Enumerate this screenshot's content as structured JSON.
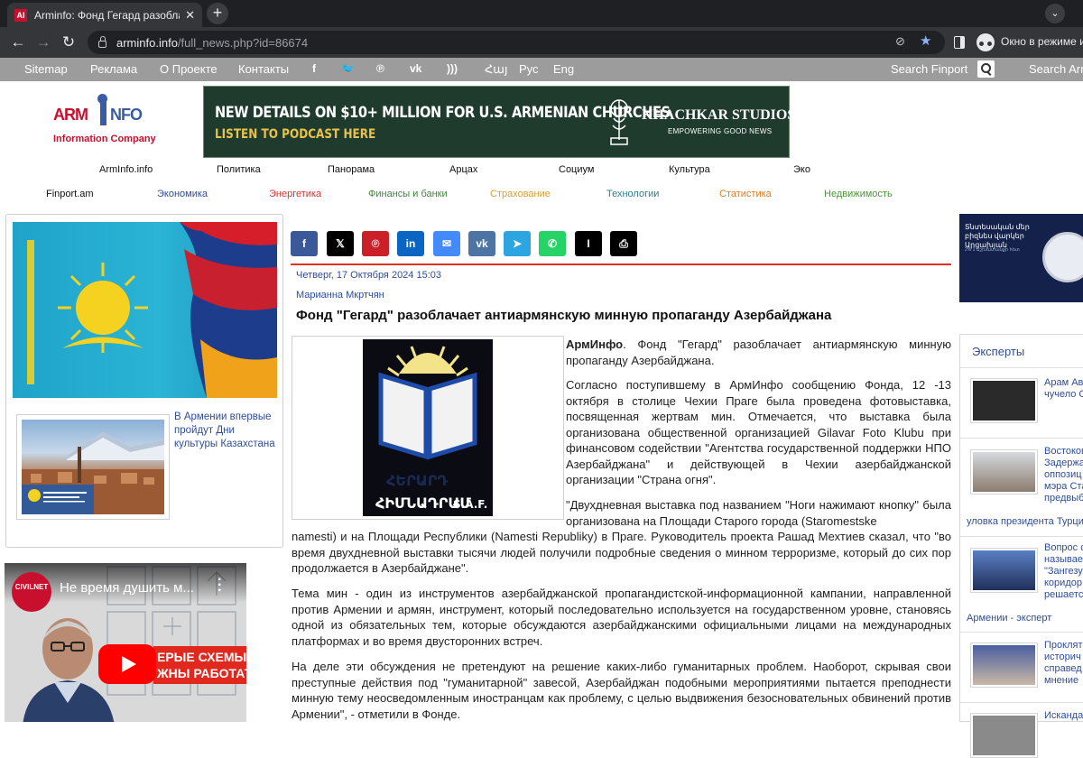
{
  "browser": {
    "tab_title": "Arminfo: Фонд Гегард разоблача",
    "favicon_text": "AI",
    "url_host": "arminfo.info",
    "url_path": "/full_news.php?id=86674",
    "incognito_label": "Окно в режиме инк"
  },
  "site_nav": {
    "links": [
      "Sitemap",
      "Реклама",
      "О Проекте",
      "Контакты"
    ],
    "social_icons": [
      "facebook-icon",
      "twitter-icon",
      "pinterest-icon",
      "vk-icon",
      "rss-icon"
    ],
    "languages": [
      "Հայ",
      "Рус",
      "Eng"
    ],
    "search_finport": "Search Finport",
    "search_arminfo": "Search Arm"
  },
  "logo": {
    "arm": "ARM",
    "info": "NFO",
    "company": "Information  Company"
  },
  "banner": {
    "headline": "NEW DETAILS ON $10+ MILLION FOR U.S. ARMENIAN CHURCHES",
    "cta": "LISTEN TO PODCAST HERE",
    "brand": "KHACHKAR STUDIOS",
    "tagline": "EMPOWERING GOOD NEWS"
  },
  "menu_row1": [
    "ArmInfo.info",
    "Политика",
    "Панорама",
    "Арцах",
    "Социум",
    "Культура",
    "Эко"
  ],
  "menu_row2": [
    "Finport.am",
    "Экономика",
    "Энергетика",
    "Финансы и банки",
    "Страхование",
    "Технологии",
    "Статистика",
    "Недвижимость"
  ],
  "colors": {
    "link_blue": "#2e4d9b",
    "energy_red": "#d9322b",
    "finance_green": "#3e8a3a",
    "insurance_gold": "#d4a23a",
    "tech_teal": "#2f7f8a",
    "stats_orange": "#e07a1f",
    "realty_green": "#4a9a34",
    "accent_red": "#e0341f"
  },
  "left": {
    "thumb_caption": "В Армении впервые пройдут Дни культуры Казахстана"
  },
  "video": {
    "channel_badge": "CIVILNET",
    "title": "Не время душить м...",
    "overlay_line1": "ЕРЫЕ СХЕМЫ",
    "overlay_line2": "ЖНЫ РАБОТАТ"
  },
  "share_buttons": [
    {
      "name": "facebook-share-button",
      "glyph": "f",
      "color": "#3b5998"
    },
    {
      "name": "x-share-button",
      "glyph": "𝕏",
      "color": "#000000"
    },
    {
      "name": "pinterest-share-button",
      "glyph": "℗",
      "color": "#cb2027"
    },
    {
      "name": "linkedin-share-button",
      "glyph": "in",
      "color": "#0a66c2"
    },
    {
      "name": "messenger-share-button",
      "glyph": "✉",
      "color": "#448aff"
    },
    {
      "name": "vk-share-button",
      "glyph": "vk",
      "color": "#4c75a3"
    },
    {
      "name": "telegram-share-button",
      "glyph": "➤",
      "color": "#2ca5e0"
    },
    {
      "name": "whatsapp-share-button",
      "glyph": "✆",
      "color": "#25d366"
    },
    {
      "name": "instapaper-share-button",
      "glyph": "I",
      "color": "#000000"
    },
    {
      "name": "print-share-button",
      "glyph": "⎙",
      "color": "#000000"
    }
  ],
  "article": {
    "date": "Четверг, 17 Октября 2024 15:03",
    "author": "Марианна Мкртчян",
    "headline": "Фонд \"Гегард\" разоблачает антиармянскую минную пропаганду Азербайджана",
    "image_caption": "ՀԻՄՆԱԴՐԱՄ",
    "image_caption2": "S.A.F.",
    "lead_bold": "АрмИнфо",
    "lead_rest": ". Фонд \"Гегард\" разоблачает антиармянскую минную пропаганду Азербайджана.",
    "p1": "Согласно поступившему в АрмИнфо сообщению Фонда, 12 -13 октября в столице Чехии Праге была проведена фотовыставка, посвященная жертвам мин. Отмечается, что выставка была организована общественной организацией Gilavar Foto Klubu при финансовом содействии \"Агентства государственной поддержки НПО Азербайджана\" и действующей в Чехии азербайджанской организации \"Страна огня\".",
    "p2_start": "\"Двухдневная выставка под названием \"Ноги нажимают кнопку\" была организована на Площади Старого города (Staromestske",
    "p2_rest": "namesti) и на Площади Республики (Namesti Republiky) в Праге.   Руководитель проекта Рашад Мехтиев сказал, что \"во время двухдневной выставки тысячи людей получили подробные сведения о минном терроризме, который до сих пор продолжается в Азербайджане\".",
    "p3": "Тема мин - один из инструментов азербайджанской пропагандистской-информационной кампании, направленной против Армении и армян, инструмент, который последовательно используется на государственном уровне, становясь одной из обязательных тем, которые обсуждаются азербайджанскими официальными лицами на международных платформах и во время двусторонних встреч.",
    "p4": "На деле эти обсуждения не претендуют на решение каких-либо гуманитарных проблем.  Наоборот, скрывая свои преступные действия под \"гуманитарной\" завесой, Азербайджан подобными мероприятиями пытается преподнести минную тему неосведомленным иностранцам как проблему, с целью выдвижения безосновательных обвинений против Армении\", - отметили в Фонде."
  },
  "right": {
    "banner_text": "Տնտեսական մեր բիզնես վարկեր Արցախյան",
    "banner_sub": "2% 1 Աշխատանքի հետ",
    "experts_title": "Эксперты",
    "experts": [
      {
        "lines": [
          "Арам Ав",
          "чучело С"
        ],
        "wide": ""
      },
      {
        "lines": [
          "Востоков",
          "Задержа",
          "оппозиц",
          "мэра Ста",
          "предвыб"
        ],
        "wide": "уловка президента Турции"
      },
      {
        "lines": [
          "Вопрос с",
          "называе",
          "\"Зангезу",
          "коридор",
          "решаетс"
        ],
        "wide": "Армении - эксперт"
      },
      {
        "lines": [
          "Проклят",
          "историч",
          "справед",
          "мнение"
        ],
        "wide": ""
      },
      {
        "lines": [
          "Искандa"
        ],
        "wide": ""
      }
    ]
  }
}
